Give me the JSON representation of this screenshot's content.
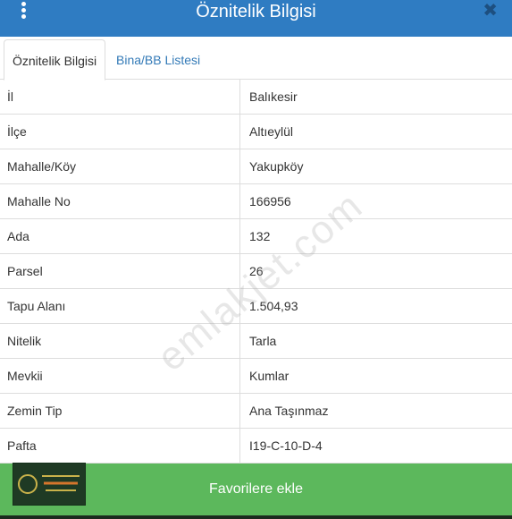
{
  "header": {
    "title": "Öznitelik Bilgisi",
    "close_glyph": "✖"
  },
  "tabs": [
    {
      "label": "Öznitelik Bilgisi",
      "active": true
    },
    {
      "label": "Bina/BB Listesi",
      "active": false
    }
  ],
  "attributes": [
    {
      "key": "İl",
      "value": "Balıkesir"
    },
    {
      "key": "İlçe",
      "value": "Altıeylül"
    },
    {
      "key": "Mahalle/Köy",
      "value": "Yakupköy"
    },
    {
      "key": "Mahalle No",
      "value": "166956"
    },
    {
      "key": "Ada",
      "value": "132"
    },
    {
      "key": "Parsel",
      "value": "26"
    },
    {
      "key": "Tapu Alanı",
      "value": "1.504,93"
    },
    {
      "key": "Nitelik",
      "value": "Tarla"
    },
    {
      "key": "Mevkii",
      "value": "Kumlar"
    },
    {
      "key": "Zemin Tip",
      "value": "Ana Taşınmaz"
    },
    {
      "key": "Pafta",
      "value": "I19-C-10-D-4"
    }
  ],
  "watermark": "emlakjet.com",
  "favorite_button_label": "Favorilere ekle",
  "colors": {
    "header_bg": "#2f7cc2",
    "tab_link": "#337ab7",
    "button_bg": "#5cb85c"
  }
}
